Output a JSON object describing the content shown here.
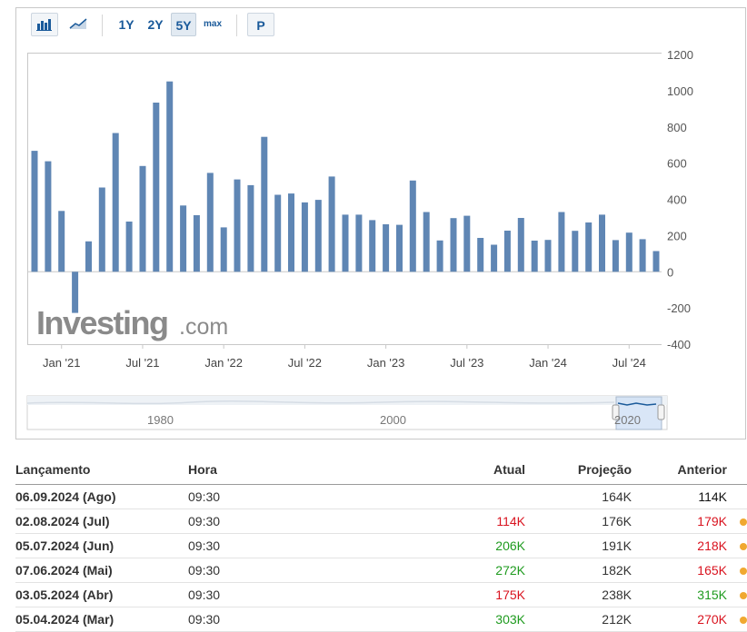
{
  "toolbar": {
    "bar_icon": "bar-chart-icon",
    "line_icon": "line-chart-icon",
    "ranges": [
      "1Y",
      "2Y",
      "5Y",
      "max"
    ],
    "selected_range": "5Y",
    "p_label": "P"
  },
  "watermark": {
    "logo_main": "Investing",
    "logo_suffix": ".com"
  },
  "chart_data": {
    "type": "bar",
    "color": "#5f86b4",
    "y_ticks": [
      1200,
      1000,
      800,
      600,
      400,
      200,
      0,
      -200,
      -400
    ],
    "ylim": [
      -400,
      1200
    ],
    "x_ticks": [
      "Jan '21",
      "Jul '21",
      "Jan '22",
      "Jul '22",
      "Jan '23",
      "Jul '23",
      "Jan '24",
      "Jul '24"
    ],
    "x_tick_index": [
      2,
      8,
      14,
      20,
      26,
      32,
      38,
      44
    ],
    "categories": [
      "Nov 2020",
      "Dec 2020",
      "Jan 2021",
      "Feb 2021",
      "Mar 2021",
      "Apr 2021",
      "May 2021",
      "Jun 2021",
      "Jul 2021",
      "Aug 2021",
      "Sep 2021",
      "Oct 2021",
      "Nov 2021",
      "Dec 2021",
      "Jan 2022",
      "Feb 2022",
      "Mar 2022",
      "Apr 2022",
      "May 2022",
      "Jun 2022",
      "Jul 2022",
      "Aug 2022",
      "Sep 2022",
      "Oct 2022",
      "Nov 2022",
      "Dec 2022",
      "Jan 2023",
      "Feb 2023",
      "Mar 2023",
      "Apr 2023",
      "May 2023",
      "Jun 2023",
      "Jul 2023",
      "Aug 2023",
      "Sep 2023",
      "Oct 2023",
      "Nov 2023",
      "Dec 2023",
      "Jan 2024",
      "Feb 2024",
      "Mar 2024",
      "Apr 2024",
      "May 2024",
      "Jun 2024",
      "Jul 2024",
      "Aug 2024"
    ],
    "values": [
      668,
      610,
      336,
      -227,
      168,
      465,
      766,
      277,
      584,
      934,
      1051,
      366,
      312,
      546,
      245,
      510,
      478,
      745,
      425,
      432,
      383,
      397,
      526,
      315,
      315,
      285,
      262,
      259,
      504,
      330,
      173,
      296,
      309,
      187,
      149,
      227,
      297,
      172,
      176,
      330,
      226,
      272,
      315,
      175,
      216,
      180,
      114
    ]
  },
  "navigator": {
    "labels": [
      "1980",
      "2000",
      "2020"
    ]
  },
  "table": {
    "headers": {
      "release": "Lançamento",
      "time": "Hora",
      "actual": "Atual",
      "forecast": "Projeção",
      "previous": "Anterior"
    },
    "rows": [
      {
        "release": "06.09.2024 (Ago)",
        "time": "09:30",
        "actual": "",
        "actual_color": "black",
        "forecast": "164K",
        "previous": "114K",
        "previous_color": "black",
        "dot": false
      },
      {
        "release": "02.08.2024 (Jul)",
        "time": "09:30",
        "actual": "114K",
        "actual_color": "red",
        "forecast": "176K",
        "previous": "179K",
        "previous_color": "red",
        "dot": true
      },
      {
        "release": "05.07.2024 (Jun)",
        "time": "09:30",
        "actual": "206K",
        "actual_color": "green",
        "forecast": "191K",
        "previous": "218K",
        "previous_color": "red",
        "dot": true
      },
      {
        "release": "07.06.2024 (Mai)",
        "time": "09:30",
        "actual": "272K",
        "actual_color": "green",
        "forecast": "182K",
        "previous": "165K",
        "previous_color": "red",
        "dot": true
      },
      {
        "release": "03.05.2024 (Abr)",
        "time": "09:30",
        "actual": "175K",
        "actual_color": "red",
        "forecast": "238K",
        "previous": "315K",
        "previous_color": "green",
        "dot": true
      },
      {
        "release": "05.04.2024 (Mar)",
        "time": "09:30",
        "actual": "303K",
        "actual_color": "green",
        "forecast": "212K",
        "previous": "270K",
        "previous_color": "red",
        "dot": true
      }
    ],
    "dot_color": "#f0a830"
  }
}
